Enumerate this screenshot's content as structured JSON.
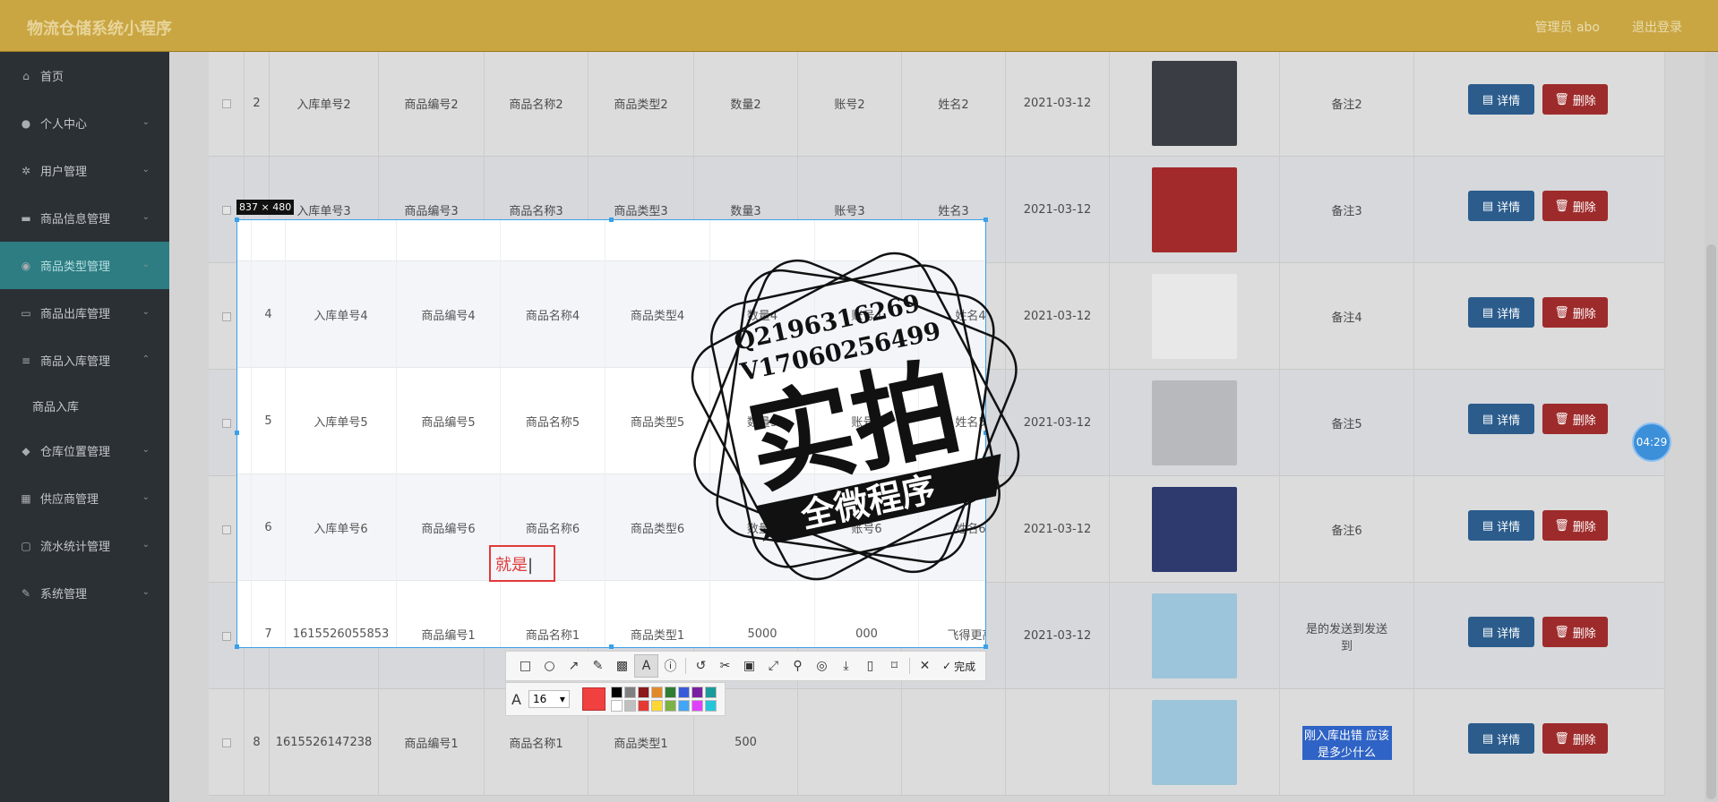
{
  "header": {
    "app_title": "物流仓储系统小程序",
    "admin_label": "管理员 abo",
    "logout_label": "退出登录"
  },
  "sidebar": {
    "items": [
      {
        "label": "首页",
        "icon": "home-icon",
        "glyph": "⌂"
      },
      {
        "label": "个人中心",
        "icon": "person-icon",
        "glyph": "●"
      },
      {
        "label": "用户管理",
        "icon": "settings-icon",
        "glyph": "✲"
      },
      {
        "label": "商品信息管理",
        "icon": "box-icon",
        "glyph": "▬"
      },
      {
        "label": "商品类型管理",
        "icon": "globe-icon",
        "glyph": "◉"
      },
      {
        "label": "商品出库管理",
        "icon": "monitor-icon",
        "glyph": "▭"
      },
      {
        "label": "商品入库管理",
        "icon": "list-icon",
        "glyph": "≡"
      },
      {
        "label": "商品入库",
        "icon": "",
        "glyph": ""
      },
      {
        "label": "仓库位置管理",
        "icon": "location-icon",
        "glyph": "◆"
      },
      {
        "label": "供应商管理",
        "icon": "grid-icon",
        "glyph": "▦"
      },
      {
        "label": "流水统计管理",
        "icon": "chat-icon",
        "glyph": "▢"
      },
      {
        "label": "系统管理",
        "icon": "tool-icon",
        "glyph": "✎"
      }
    ]
  },
  "table": {
    "rows": [
      {
        "no": "2",
        "order": "入库单号2",
        "code": "商品编号2",
        "name": "商品名称2",
        "type": "商品类型2",
        "qty": "数量2",
        "account": "账号2",
        "person": "姓名2",
        "date": "2021-03-12",
        "note": "备注2",
        "img_color": "#3a3d44"
      },
      {
        "no": "3",
        "order": "入库单号3",
        "code": "商品编号3",
        "name": "商品名称3",
        "type": "商品类型3",
        "qty": "数量3",
        "account": "账号3",
        "person": "姓名3",
        "date": "2021-03-12",
        "note": "备注3",
        "img_color": "#a32a2a"
      },
      {
        "no": "4",
        "order": "入库单号4",
        "code": "商品编号4",
        "name": "商品名称4",
        "type": "商品类型4",
        "qty": "数量4",
        "account": "账号4",
        "person": "姓名4",
        "date": "2021-03-12",
        "note": "备注4",
        "img_color": "#e8e8e8"
      },
      {
        "no": "5",
        "order": "入库单号5",
        "code": "商品编号5",
        "name": "商品名称5",
        "type": "商品类型5",
        "qty": "数量5",
        "account": "账号5",
        "person": "姓名5",
        "date": "2021-03-12",
        "note": "备注5",
        "img_color": "#b7b9bd"
      },
      {
        "no": "6",
        "order": "入库单号6",
        "code": "商品编号6",
        "name": "商品名称6",
        "type": "商品类型6",
        "qty": "数量6",
        "account": "账号6",
        "person": "姓名6",
        "date": "2021-03-12",
        "note": "备注6",
        "img_color": "#2e3a6e"
      },
      {
        "no": "7",
        "order": "1615526055853",
        "code": "商品编号1",
        "name": "商品名称1",
        "type": "商品类型1",
        "qty": "5000",
        "account": "000",
        "person": "飞得更高",
        "date": "2021-03-12",
        "note": "是的发送到发送到",
        "img_color": "#9cc4da"
      },
      {
        "no": "8",
        "order": "1615526147238",
        "code": "商品编号1",
        "name": "商品名称1",
        "type": "商品类型1",
        "qty": "500",
        "account": "",
        "person": "",
        "date": "",
        "note": "刚入库出错 应该是多少什么",
        "img_color": "#9cc4da"
      }
    ],
    "detail_label": "详情",
    "delete_label": "删除"
  },
  "screenshot_tool": {
    "size_label": "837 × 480",
    "typed_text": "就是",
    "done_label": "完成",
    "font_size": "16",
    "current_color": "#f04040",
    "swatches": [
      "#000000",
      "#808080",
      "#8b1a1a",
      "#e08a2a",
      "#2e7d32",
      "#3a5bd9",
      "#7b1fa2",
      "#1a9a9a",
      "#ffffff",
      "#c0c0c0",
      "#e53935",
      "#fdd835",
      "#7cb342",
      "#42a5f5",
      "#e040fb",
      "#26c6da"
    ]
  },
  "stamp": {
    "line1": "Q2196316269",
    "line2": "V17060256499",
    "big": "实拍",
    "banner": "全微程序"
  },
  "timer": "04:29"
}
